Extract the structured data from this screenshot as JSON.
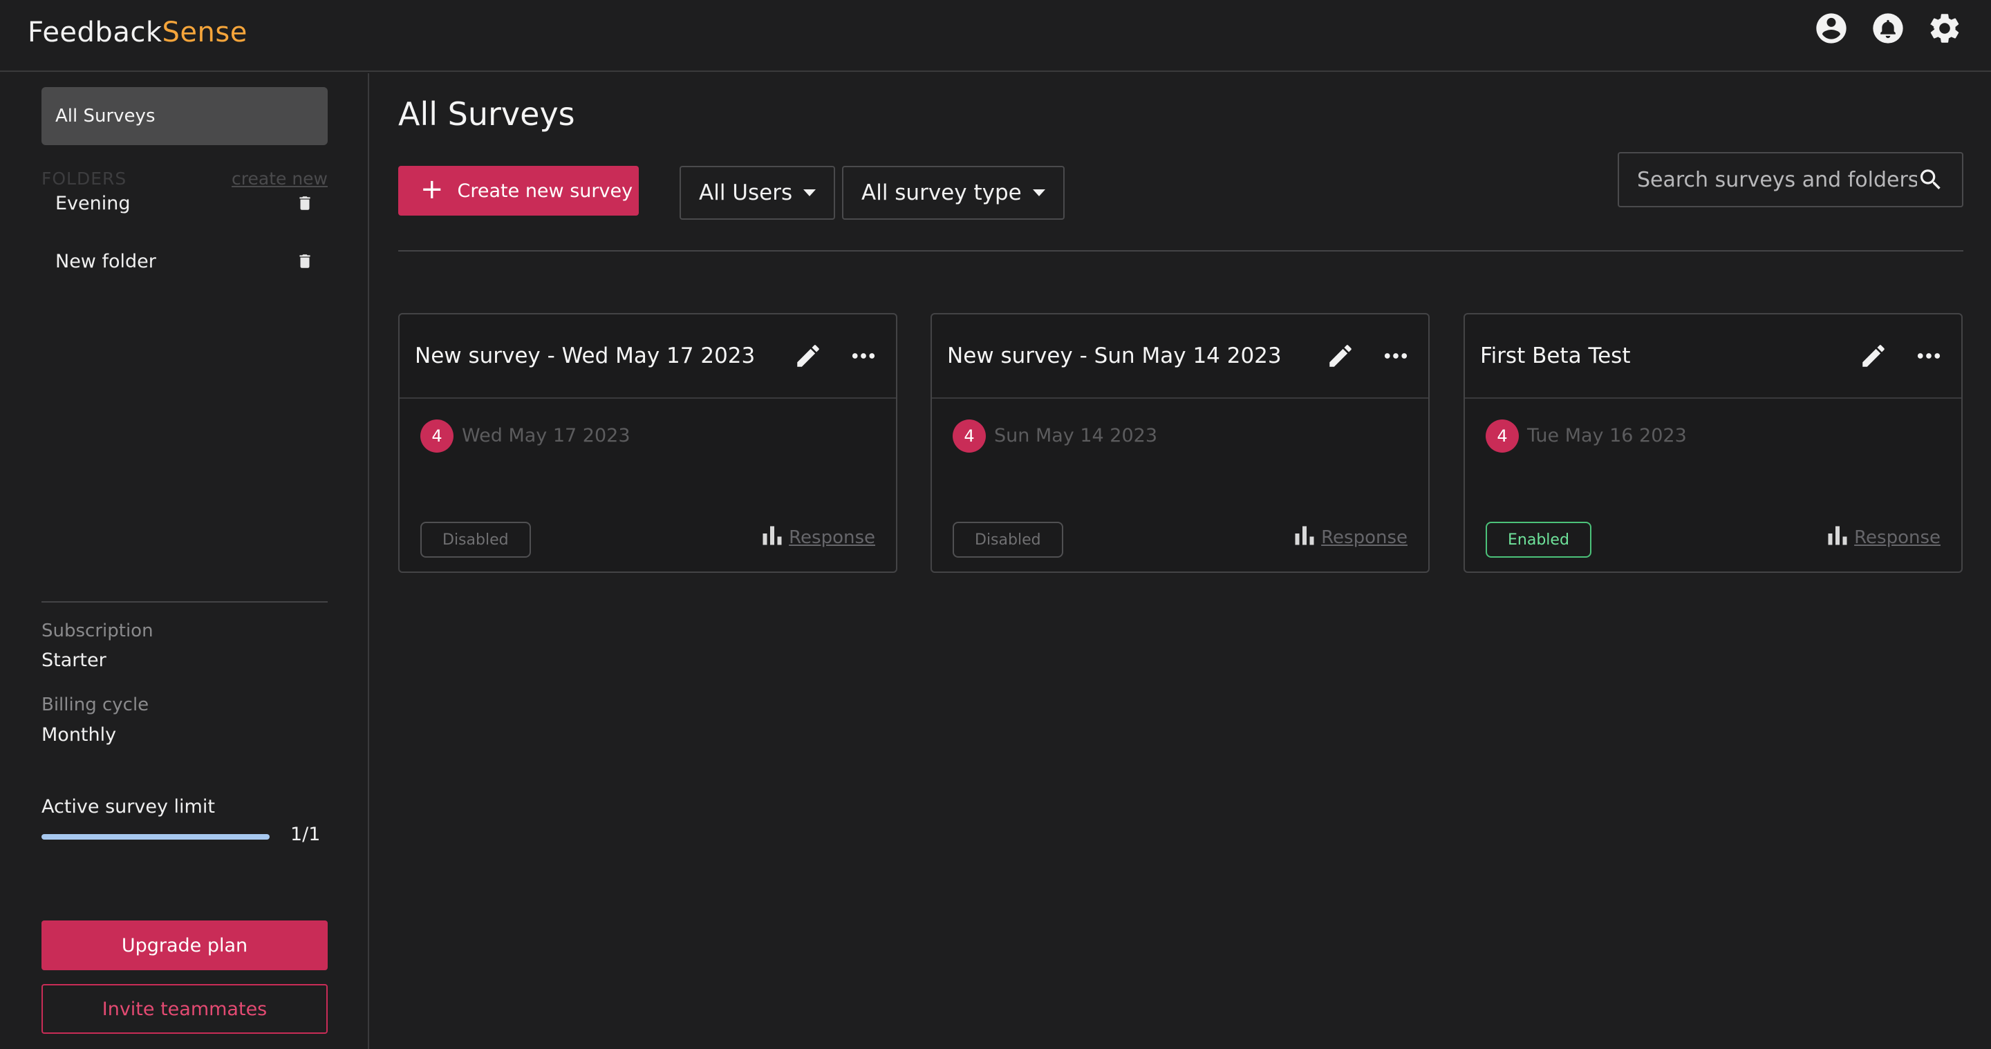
{
  "app": {
    "logo_main": "Feedback",
    "logo_accent": "Sense"
  },
  "topbar": {
    "icons": [
      "account-circle-icon",
      "bell-icon",
      "gear-icon"
    ]
  },
  "sidebar": {
    "active_item": "All Surveys",
    "folders_label": "FOLDERS",
    "create_new": "create new",
    "folders": [
      {
        "label": "Evening"
      },
      {
        "label": "New folder"
      }
    ],
    "subscription_label": "Subscription",
    "subscription_value": "Starter",
    "billing_label": "Billing cycle",
    "billing_value": "Monthly",
    "limit_label": "Active survey limit",
    "limit_count": "1/1",
    "limit_fraction": 1.0,
    "upgrade_label": "Upgrade plan",
    "invite_label": "Invite teammates"
  },
  "main": {
    "title": "All Surveys",
    "create_label": "Create new survey",
    "users_filter": "All Users",
    "type_filter": "All survey type",
    "search_placeholder": "Search surveys and folders"
  },
  "cards": [
    {
      "title": "New survey - Wed May 17 2023",
      "count": "4",
      "date": "Wed May 17 2023",
      "status": "Disabled",
      "response": "Response"
    },
    {
      "title": "New survey - Sun May 14 2023",
      "count": "4",
      "date": "Sun May 14 2023",
      "status": "Disabled",
      "response": "Response"
    },
    {
      "title": "First Beta Test",
      "count": "4",
      "date": "Tue May 16 2023",
      "status": "Enabled",
      "response": "Response"
    }
  ],
  "colors": {
    "accent": "#c92c57",
    "logo_accent": "#f5a53b",
    "enabled": "#4cc27a",
    "progress": "#a7c8ef"
  }
}
